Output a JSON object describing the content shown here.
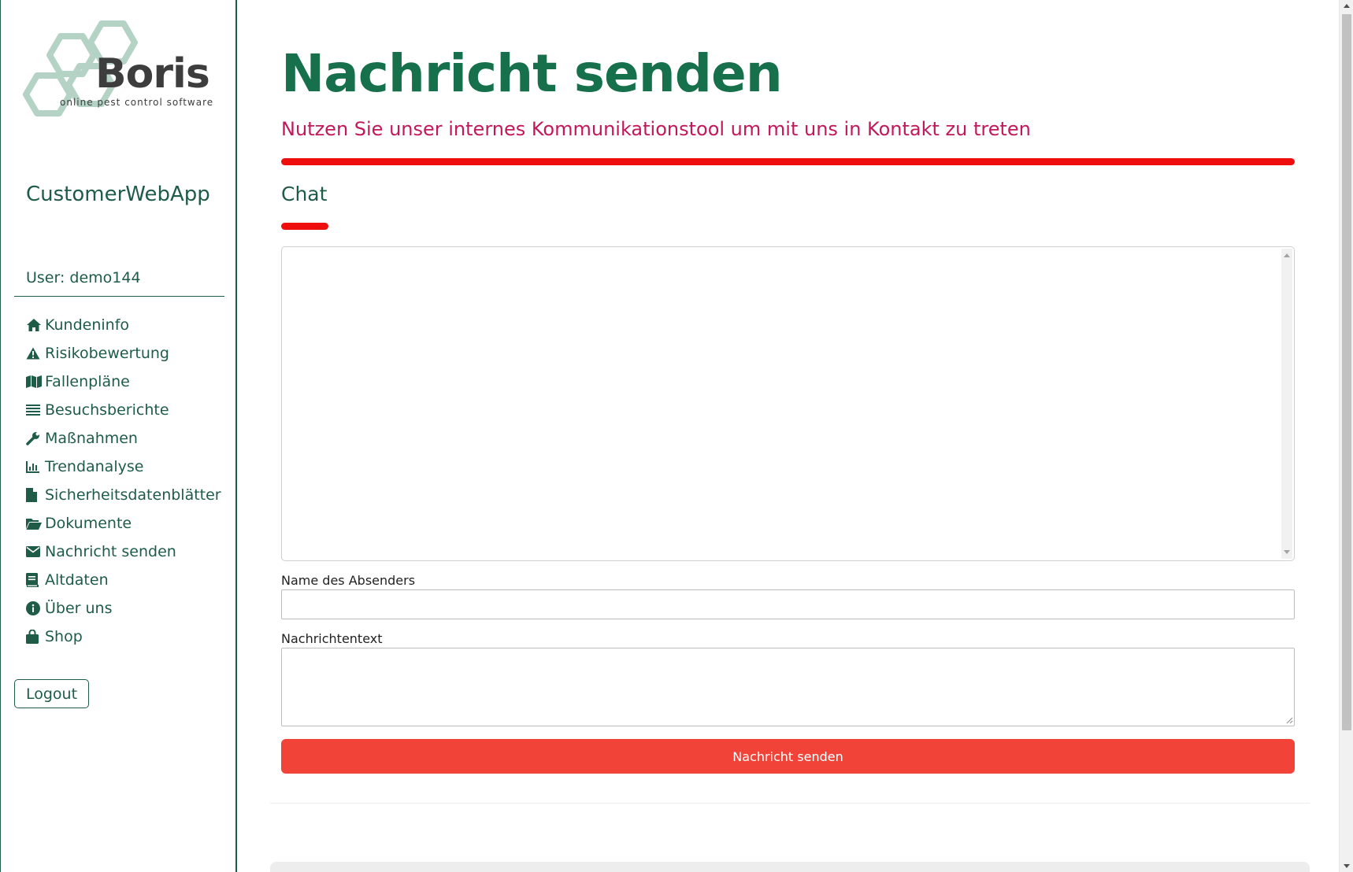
{
  "logo": {
    "wordmark": "Boris",
    "tagline": "online pest control software"
  },
  "sidebar": {
    "app_name": "CustomerWebApp",
    "user_label": "User: demo144",
    "items": [
      {
        "label": "Kundeninfo",
        "icon": "home-icon"
      },
      {
        "label": "Risikobewertung",
        "icon": "warning-icon"
      },
      {
        "label": "Fallenpläne",
        "icon": "map-icon"
      },
      {
        "label": "Besuchsberichte",
        "icon": "list-icon"
      },
      {
        "label": "Maßnahmen",
        "icon": "wrench-icon"
      },
      {
        "label": "Trendanalyse",
        "icon": "bar-chart-icon"
      },
      {
        "label": "Sicherheitsdatenblätter",
        "icon": "file-icon"
      },
      {
        "label": "Dokumente",
        "icon": "folder-open-icon"
      },
      {
        "label": "Nachricht senden",
        "icon": "envelope-icon"
      },
      {
        "label": "Altdaten",
        "icon": "book-icon"
      },
      {
        "label": "Über uns",
        "icon": "info-icon"
      },
      {
        "label": "Shop",
        "icon": "shopping-bag-icon"
      }
    ],
    "logout_label": "Logout"
  },
  "main": {
    "title": "Nachricht senden",
    "subtitle": "Nutzen Sie unser internes Kommunikationstool um mit uns in Kontakt zu treten",
    "section_title": "Chat",
    "chat_content": "",
    "sender_label": "Name des Absenders",
    "sender_value": "",
    "message_label": "Nachrichtentext",
    "message_value": "",
    "submit_label": "Nachricht senden"
  },
  "colors": {
    "brand_green": "#1e5c47",
    "title_green": "#16704b",
    "subtitle_magenta": "#c2185b",
    "accent_red": "#ee0e0e",
    "button_red": "#f24338",
    "logo_hex": "#b5d3c5"
  }
}
